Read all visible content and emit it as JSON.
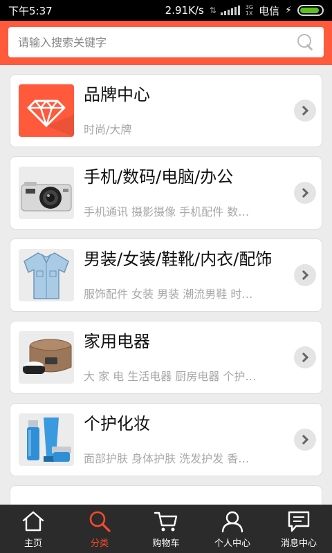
{
  "status_bar": {
    "time": "下午5:37",
    "speed": "2.91K/s",
    "network_top": "3G",
    "network_bottom": "1X",
    "carrier": "电信",
    "battery_level": 0.9
  },
  "search": {
    "placeholder": "请输入搜索关键字",
    "value": ""
  },
  "categories": [
    {
      "title": "品牌中心",
      "subtitle": "时尚/大牌",
      "image_icon": "diamond-icon"
    },
    {
      "title": "手机/数码/电脑/办公",
      "subtitle": "手机通讯 摄影摄像 手机配件 数…",
      "image_icon": "camera-image"
    },
    {
      "title": "男装/女装/鞋靴/内衣/配饰",
      "subtitle": "服饰配件 女装 男装 潮流男鞋 时…",
      "image_icon": "shirt-image"
    },
    {
      "title": "家用电器",
      "subtitle": "大 家 电 生活电器 厨房电器 个护…",
      "image_icon": "rice-cooker-image"
    },
    {
      "title": "个护化妆",
      "subtitle": "面部护肤 身体护肤 洗发护发 香…",
      "image_icon": "cosmetics-image"
    }
  ],
  "tab_bar": {
    "active_index": 1,
    "tabs": [
      {
        "label": "主页",
        "icon": "home-icon"
      },
      {
        "label": "分类",
        "icon": "search-icon"
      },
      {
        "label": "购物车",
        "icon": "cart-icon"
      },
      {
        "label": "个人中心",
        "icon": "user-icon"
      },
      {
        "label": "消息中心",
        "icon": "message-icon"
      }
    ]
  },
  "colors": {
    "accent": "#ff5a3c",
    "tab_bar_bg": "#2b2b2b",
    "active_tab": "#ff4a2a"
  }
}
